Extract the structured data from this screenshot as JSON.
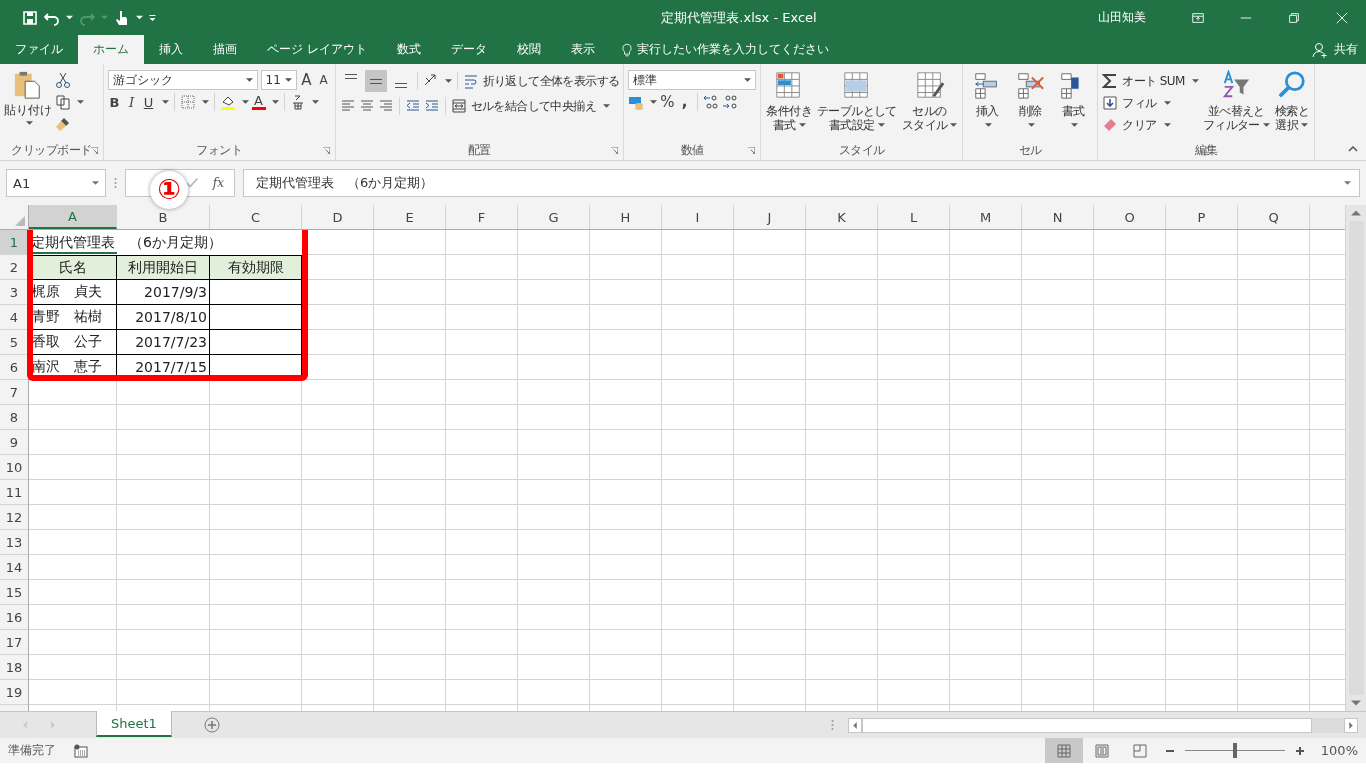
{
  "window": {
    "title": "定期代管理表.xlsx  -  Excel",
    "user": "山田知美"
  },
  "tabs": [
    {
      "label": "ファイル",
      "selected": false
    },
    {
      "label": "ホーム",
      "selected": true
    },
    {
      "label": "挿入",
      "selected": false
    },
    {
      "label": "描画",
      "selected": false
    },
    {
      "label": "ページ レイアウト",
      "selected": false
    },
    {
      "label": "数式",
      "selected": false
    },
    {
      "label": "データ",
      "selected": false
    },
    {
      "label": "校閲",
      "selected": false
    },
    {
      "label": "表示",
      "selected": false
    }
  ],
  "tell_me": "実行したい作業を入力してください",
  "share": "共有",
  "ribbon": {
    "clipboard": {
      "label": "クリップボード",
      "paste": "貼り付け"
    },
    "font": {
      "label": "フォント",
      "font_name": "游ゴシック",
      "font_size": "11",
      "grow": "A",
      "shrink": "A",
      "bold": "B",
      "italic": "I",
      "underline": "U",
      "font_color": "A"
    },
    "alignment": {
      "label": "配置",
      "vertical": [
        {
          "selected": false
        },
        {
          "selected": true
        },
        {
          "selected": false
        }
      ],
      "wrap": "折り返して全体を表示する",
      "merge": "セルを結合して中央揃え"
    },
    "number": {
      "label": "数値",
      "format": "標準",
      "percent": "%",
      "comma": ","
    },
    "styles": {
      "label": "スタイル",
      "buttons": [
        {
          "lines": [
            "条件付き",
            "書式"
          ]
        },
        {
          "lines": [
            "テーブルとして",
            "書式設定"
          ]
        },
        {
          "lines": [
            "セルの",
            "スタイル"
          ]
        }
      ]
    },
    "cells": {
      "label": "セル",
      "buttons": [
        "挿入",
        "削除",
        "書式"
      ]
    },
    "editing": {
      "label": "編集",
      "autosum": "オート SUM",
      "fill": "フィル",
      "clear": "クリア",
      "sort": [
        "並べ替えと",
        "フィルター"
      ],
      "find": [
        "検索と",
        "選択"
      ]
    }
  },
  "formula_bar": {
    "name_box": "A1",
    "fx": "fx",
    "formula": "定期代管理表　（6か月定期）"
  },
  "callout": "①",
  "columns": [
    "A",
    "B",
    "C",
    "D",
    "E",
    "F",
    "G",
    "H",
    "I",
    "J",
    "K",
    "L",
    "M",
    "N",
    "O",
    "P",
    "Q"
  ],
  "row_numbers": [
    "1",
    "2",
    "3",
    "4",
    "5",
    "6",
    "7",
    "8",
    "9",
    "10",
    "11",
    "12",
    "13",
    "14",
    "15",
    "16",
    "17",
    "18",
    "19"
  ],
  "table": {
    "title": "定期代管理表　（6か月定期）",
    "header": [
      "氏名",
      "利用開始日",
      "有効期限"
    ],
    "rows": [
      {
        "name": "梶原　貞夫",
        "start": "2017/9/3"
      },
      {
        "name": "青野　祐樹",
        "start": "2017/8/10"
      },
      {
        "name": "香取　公子",
        "start": "2017/7/23"
      },
      {
        "name": "南沢　恵子",
        "start": "2017/7/15"
      }
    ]
  },
  "sheet_tabs": [
    {
      "label": "Sheet1",
      "selected": true
    }
  ],
  "status": {
    "text": "準備完了",
    "views": [
      {
        "kind": "normal",
        "selected": true
      },
      {
        "kind": "page_layout",
        "selected": false
      },
      {
        "kind": "page_break",
        "selected": false
      }
    ],
    "zoom": {
      "level": 0.5
    },
    "zoom_text": "100%"
  }
}
